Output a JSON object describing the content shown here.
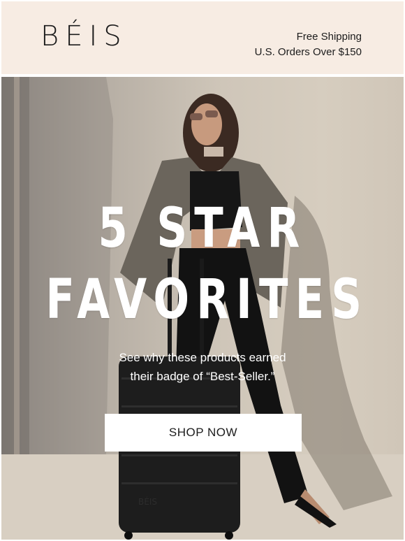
{
  "header": {
    "brand": "BÉIS",
    "shipping_line1": "Free Shipping",
    "shipping_line2": "U.S. Orders Over $150"
  },
  "hero": {
    "headline_line1": "5 STAR",
    "headline_line2": "FAVORITES",
    "subtext_line1": "See why these products earned",
    "subtext_line2": "their badge of “Best-Seller.”",
    "cta_label": "SHOP NOW",
    "suitcase_brand": "BÉIS"
  },
  "colors": {
    "header_bg": "#f7ece3",
    "text_dark": "#1c1c1c",
    "button_bg": "#ffffff"
  }
}
